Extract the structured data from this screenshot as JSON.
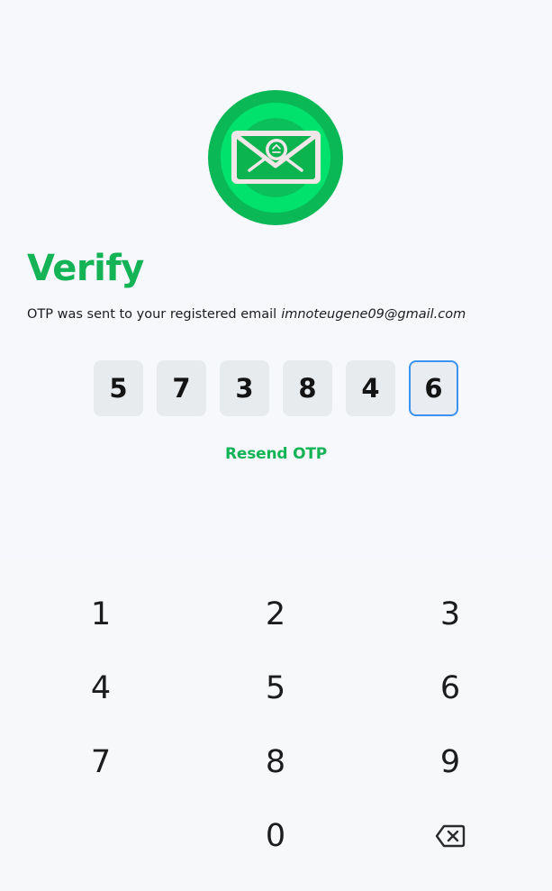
{
  "header": {
    "title": "Verify",
    "subtitle_prefix": "OTP was sent to your registered email",
    "email": "imnoteugene09@gmail.com"
  },
  "logo": {
    "icon": "email-envelope-icon",
    "outer_color": "#0bb856",
    "inner_color": "#00e26b",
    "envelope_color": "#f1e6e8"
  },
  "otp": {
    "digits": [
      "5",
      "7",
      "3",
      "8",
      "4",
      "6"
    ],
    "active_index": 5
  },
  "resend_label": "Resend OTP",
  "keypad": {
    "keys": [
      "1",
      "2",
      "3",
      "4",
      "5",
      "6",
      "7",
      "8",
      "9",
      "",
      "0"
    ],
    "backspace_icon": "backspace-icon"
  },
  "colors": {
    "accent": "#14b356",
    "focus_border": "#3a93f0",
    "box_bg": "#e8ebee"
  }
}
